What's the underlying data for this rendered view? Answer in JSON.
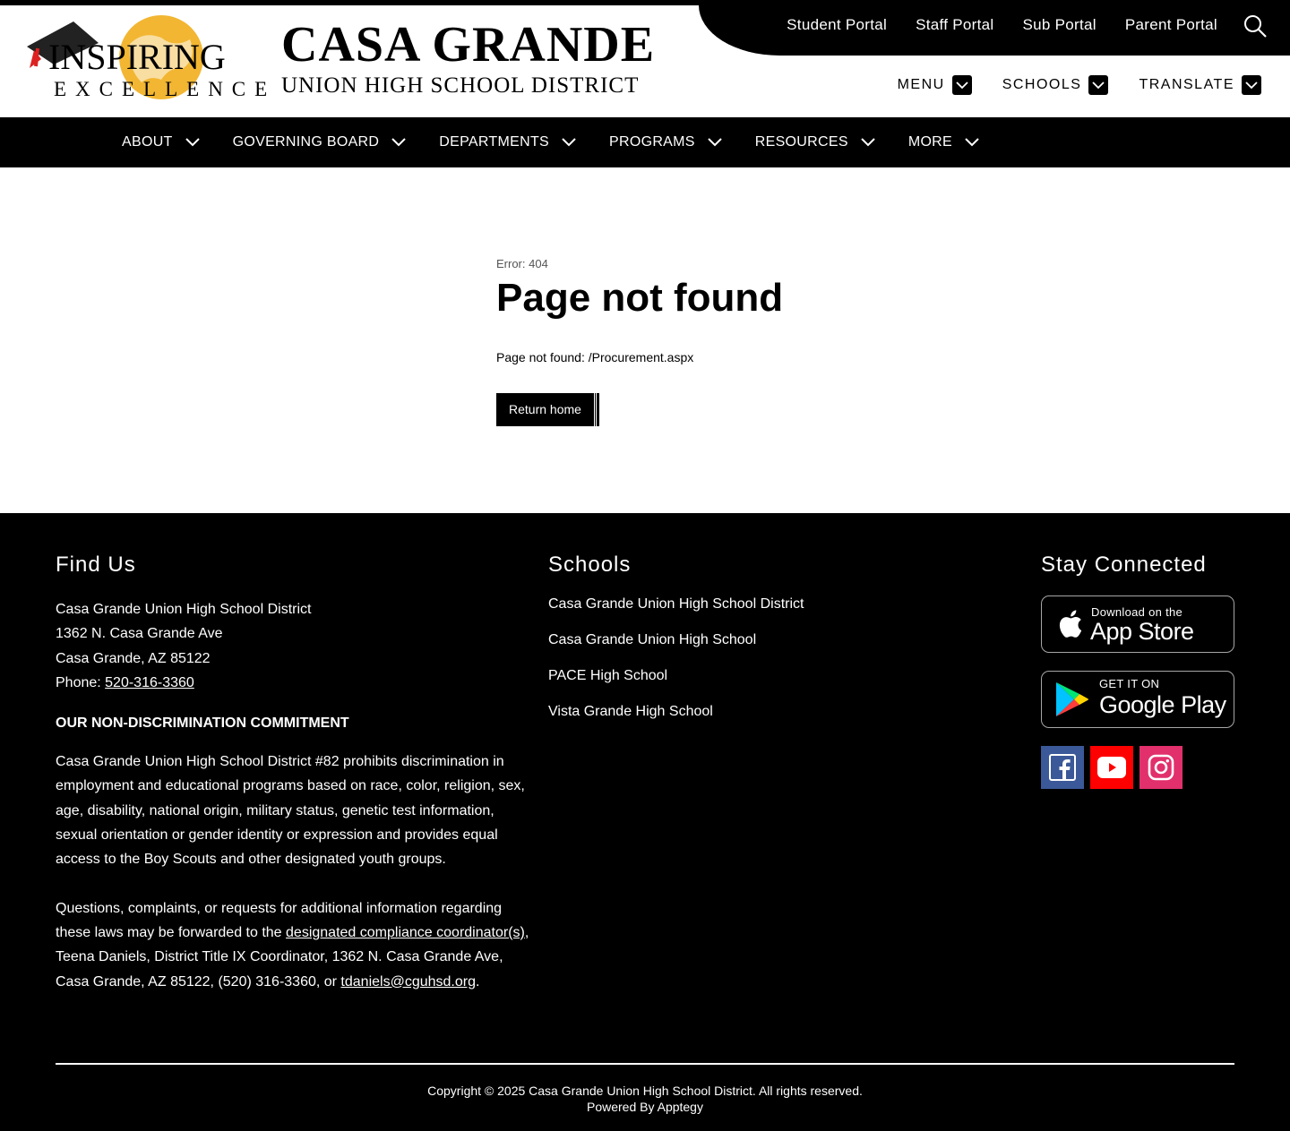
{
  "header": {
    "logo": {
      "line1": "INSPIRING",
      "line2": "EXCELLENCE"
    },
    "brand": {
      "title": "CASA GRANDE",
      "subtitle": "UNION HIGH SCHOOL DISTRICT"
    },
    "portals": [
      {
        "label": "Student Portal"
      },
      {
        "label": "Staff Portal"
      },
      {
        "label": "Sub Portal"
      },
      {
        "label": "Parent Portal"
      }
    ],
    "search_icon": "search-icon",
    "utility_nav": [
      {
        "label": "MENU"
      },
      {
        "label": "SCHOOLS"
      },
      {
        "label": "TRANSLATE"
      }
    ]
  },
  "main_nav": [
    {
      "label": "ABOUT"
    },
    {
      "label": "GOVERNING BOARD"
    },
    {
      "label": "DEPARTMENTS"
    },
    {
      "label": "PROGRAMS"
    },
    {
      "label": "RESOURCES"
    },
    {
      "label": "MORE"
    }
  ],
  "content": {
    "error_code": "Error: 404",
    "title": "Page not found",
    "message": "Page not found: /Procurement.aspx",
    "button_label": "Return home"
  },
  "footer": {
    "find_us": {
      "heading": "Find Us",
      "org": "Casa Grande Union High School District",
      "street": "1362 N. Casa Grande Ave",
      "city": "Casa Grande, AZ 85122",
      "phone_label": "Phone: ",
      "phone": "520-316-3360",
      "ndc_title": "OUR NON-DISCRIMINATION COMMITMENT",
      "ndc_text": "Casa Grande Union High School District #82 prohibits discrimination in employment and educational programs based on race, color, religion, sex, age, disability, national origin, military status, genetic test information, sexual orientation or gender identity or expression and provides equal access to the Boy Scouts and other designated youth groups.",
      "questions_pre": "Questions, complaints, or requests for additional information regarding these laws may be forwarded to the ",
      "questions_link": "designated compliance coordinator(s)",
      "questions_mid": ", Teena Daniels, District Title IX Coordinator, 1362 N. Casa Grande Ave, Casa Grande, AZ 85122, (520) 316-3360, or ",
      "email": "tdaniels@cguhsd.org",
      "questions_end": "."
    },
    "schools": {
      "heading": "Schools",
      "items": [
        {
          "label": "Casa Grande Union High School District"
        },
        {
          "label": "Casa Grande Union High School"
        },
        {
          "label": "PACE High School"
        },
        {
          "label": "Vista Grande High School"
        }
      ]
    },
    "stay_connected": {
      "heading": "Stay Connected",
      "app_store": {
        "small": "Download on the",
        "big": "App Store"
      },
      "google_play": {
        "small": "GET IT ON",
        "big": "Google Play"
      },
      "social": [
        {
          "icon": "facebook-icon",
          "color": "#3b5998"
        },
        {
          "icon": "youtube-icon",
          "color": "#ff0000"
        },
        {
          "icon": "instagram-icon",
          "color": "#e1306c"
        }
      ]
    },
    "copyright": "Copyright © 2025 Casa Grande Union High School District. All rights reserved.",
    "powered_by": "Powered By Apptegy"
  }
}
